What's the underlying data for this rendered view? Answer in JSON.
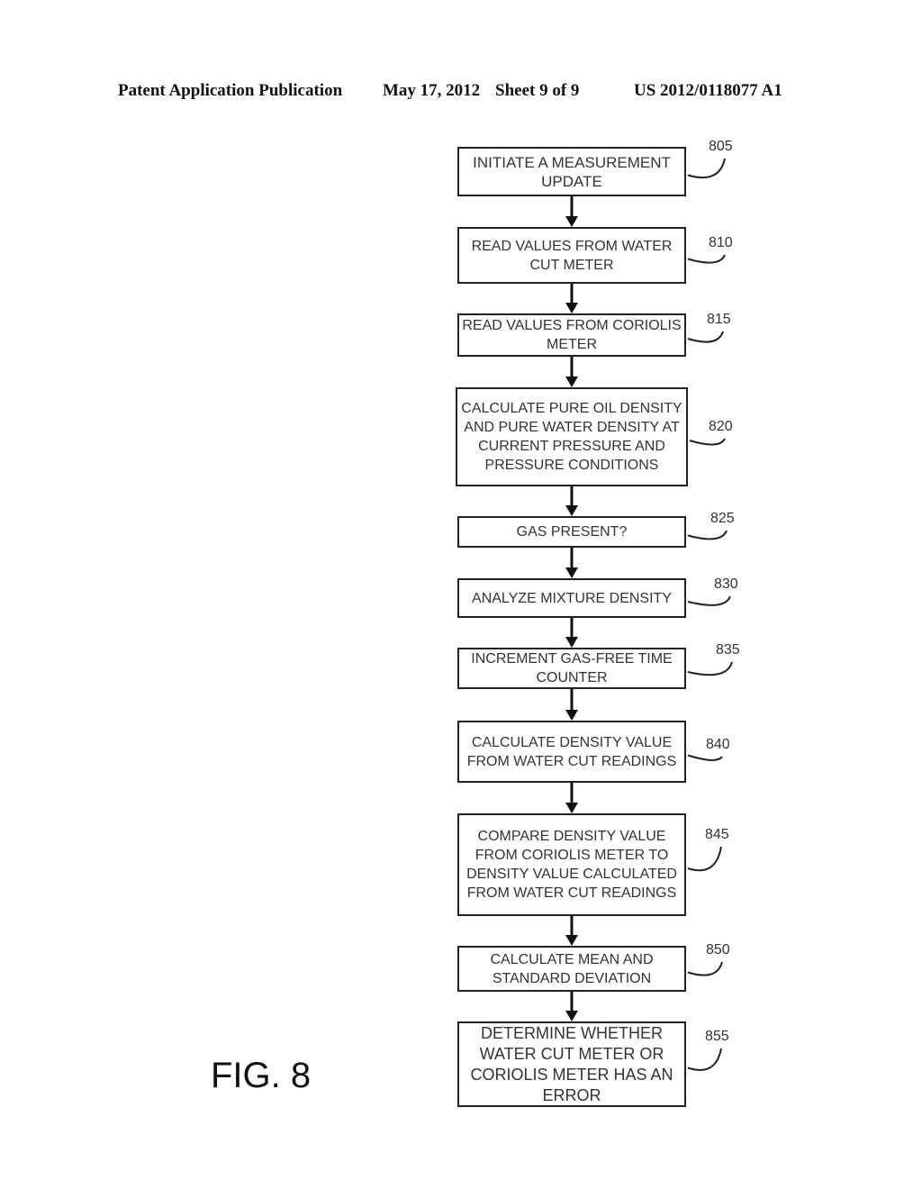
{
  "header": {
    "publication": "Patent Application Publication",
    "date": "May 17, 2012",
    "sheet": "Sheet 9 of 9",
    "number": "US 2012/0118077 A1"
  },
  "figure_label": "FIG. 8",
  "steps": [
    {
      "ref": "805",
      "text": "INITIATE A MEASUREMENT UPDATE"
    },
    {
      "ref": "810",
      "text": "READ VALUES FROM WATER CUT METER"
    },
    {
      "ref": "815",
      "text": "READ VALUES FROM CORIOLIS METER"
    },
    {
      "ref": "820",
      "text": "CALCULATE PURE OIL DENSITY AND PURE WATER DENSITY AT CURRENT PRESSURE AND PRESSURE CONDITIONS"
    },
    {
      "ref": "825",
      "text": "GAS PRESENT?"
    },
    {
      "ref": "830",
      "text": "ANALYZE MIXTURE DENSITY"
    },
    {
      "ref": "835",
      "text": "INCREMENT GAS-FREE TIME COUNTER"
    },
    {
      "ref": "840",
      "text": "CALCULATE DENSITY VALUE FROM WATER CUT READINGS"
    },
    {
      "ref": "845",
      "text": "COMPARE DENSITY VALUE FROM CORIOLIS METER TO DENSITY VALUE CALCULATED FROM WATER CUT READINGS"
    },
    {
      "ref": "850",
      "text": "CALCULATE MEAN AND STANDARD DEVIATION"
    },
    {
      "ref": "855",
      "text": "DETERMINE WHETHER WATER CUT METER OR CORIOLIS METER HAS AN ERROR"
    }
  ]
}
